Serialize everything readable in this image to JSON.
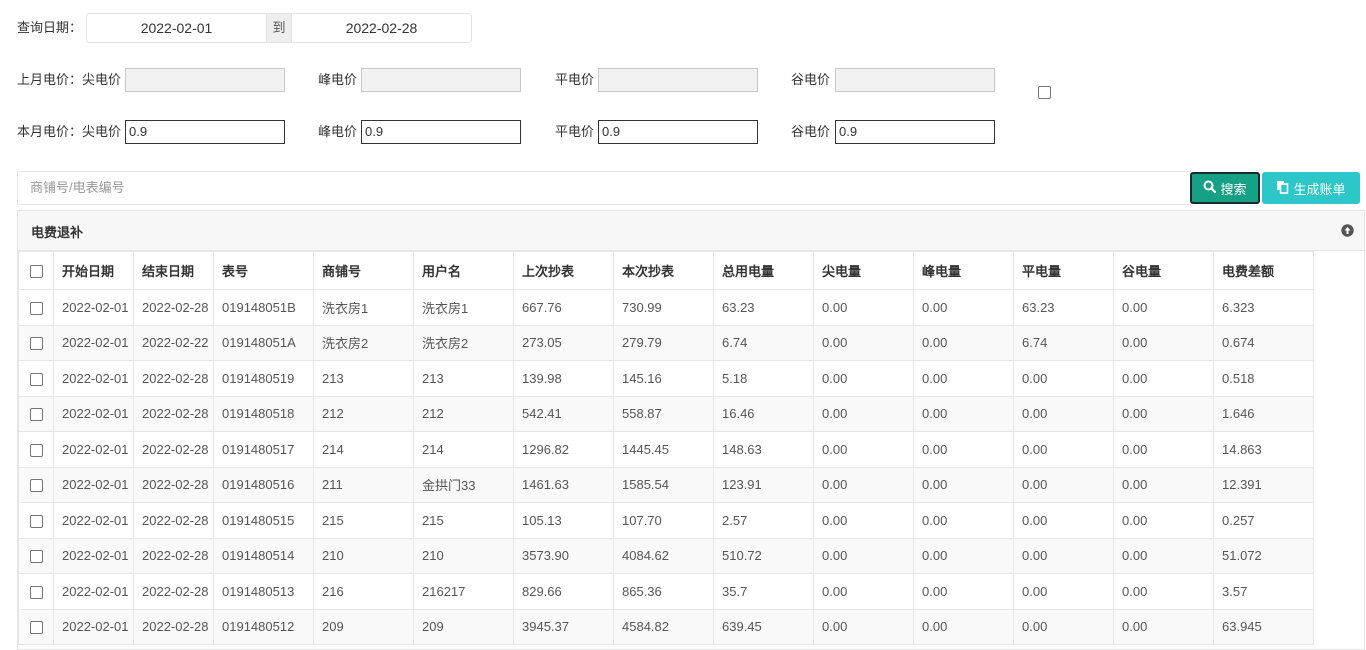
{
  "filters": {
    "date_label": "查询日期：",
    "start_date": "2022-02-01",
    "to_label": "到",
    "end_date": "2022-02-28",
    "last_month": {
      "label": "上月电价：",
      "sharp_label": "尖电价",
      "sharp_value": "",
      "peak_label": "峰电价",
      "peak_value": "",
      "flat_label": "平电价",
      "flat_value": "",
      "valley_label": "谷电价",
      "valley_value": ""
    },
    "this_month": {
      "label": "本月电价：",
      "sharp_label": "尖电价",
      "sharp_value": "0.9",
      "peak_label": "峰电价",
      "peak_value": "0.9",
      "flat_label": "平电价",
      "flat_value": "0.9",
      "valley_label": "谷电价",
      "valley_value": "0.9"
    }
  },
  "search": {
    "placeholder": "商铺号/电表编号",
    "search_label": "搜索",
    "bill_label": "生成账单"
  },
  "panel": {
    "title": "电费退补"
  },
  "table": {
    "columns": [
      "开始日期",
      "结束日期",
      "表号",
      "商铺号",
      "用户名",
      "上次抄表",
      "本次抄表",
      "总用电量",
      "尖电量",
      "峰电量",
      "平电量",
      "谷电量",
      "电费差额"
    ],
    "rows": [
      [
        "2022-02-01",
        "2022-02-28",
        "019148051B",
        "洗衣房1",
        "洗衣房1",
        "667.76",
        "730.99",
        "63.23",
        "0.00",
        "0.00",
        "63.23",
        "0.00",
        "6.323"
      ],
      [
        "2022-02-01",
        "2022-02-22",
        "019148051A",
        "洗衣房2",
        "洗衣房2",
        "273.05",
        "279.79",
        "6.74",
        "0.00",
        "0.00",
        "6.74",
        "0.00",
        "0.674"
      ],
      [
        "2022-02-01",
        "2022-02-28",
        "0191480519",
        "213",
        "213",
        "139.98",
        "145.16",
        "5.18",
        "0.00",
        "0.00",
        "0.00",
        "0.00",
        "0.518"
      ],
      [
        "2022-02-01",
        "2022-02-28",
        "0191480518",
        "212",
        "212",
        "542.41",
        "558.87",
        "16.46",
        "0.00",
        "0.00",
        "0.00",
        "0.00",
        "1.646"
      ],
      [
        "2022-02-01",
        "2022-02-28",
        "0191480517",
        "214",
        "214",
        "1296.82",
        "1445.45",
        "148.63",
        "0.00",
        "0.00",
        "0.00",
        "0.00",
        "14.863"
      ],
      [
        "2022-02-01",
        "2022-02-28",
        "0191480516",
        "211",
        "金拱门33",
        "1461.63",
        "1585.54",
        "123.91",
        "0.00",
        "0.00",
        "0.00",
        "0.00",
        "12.391"
      ],
      [
        "2022-02-01",
        "2022-02-28",
        "0191480515",
        "215",
        "215",
        "105.13",
        "107.70",
        "2.57",
        "0.00",
        "0.00",
        "0.00",
        "0.00",
        "0.257"
      ],
      [
        "2022-02-01",
        "2022-02-28",
        "0191480514",
        "210",
        "210",
        "3573.90",
        "4084.62",
        "510.72",
        "0.00",
        "0.00",
        "0.00",
        "0.00",
        "51.072"
      ],
      [
        "2022-02-01",
        "2022-02-28",
        "0191480513",
        "216",
        "216217",
        "829.66",
        "865.36",
        "35.7",
        "0.00",
        "0.00",
        "0.00",
        "0.00",
        "3.57"
      ],
      [
        "2022-02-01",
        "2022-02-28",
        "0191480512",
        "209",
        "209",
        "3945.37",
        "4584.82",
        "639.45",
        "0.00",
        "0.00",
        "0.00",
        "0.00",
        "63.945"
      ]
    ]
  },
  "colors": {
    "search_button": "#16a086",
    "bill_button": "#2ec7c9"
  }
}
